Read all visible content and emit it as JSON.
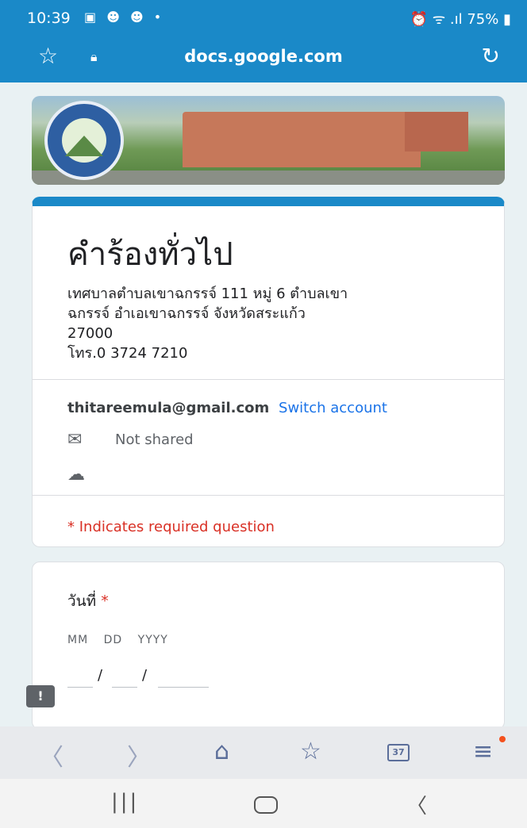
{
  "status_bar": {
    "time": "10:39",
    "notification_icons": "▣ ☻ ☻ •",
    "right_status": "⏰ ᯤ .ıl 75% ▮"
  },
  "browser": {
    "url": "docs.google.com"
  },
  "form": {
    "title": "คำร้องทั่วไป",
    "description_lines": [
      "เทศบาลตำบลเขาฉกรรจ์ 111 หมู่ 6 ตำบลเขา",
      "ฉกรรจ์ อำเอเขาฉกรรจ์ จังหวัดสระแก้ว",
      "27000",
      "โทร.0 3724 7210"
    ],
    "account_email": "thitareemula@gmail.com",
    "switch_account_label": "Switch account",
    "not_shared_label": "Not shared",
    "required_note": "* Indicates required question"
  },
  "question": {
    "label": "วันที่",
    "required_mark": "*",
    "date_format": {
      "mm": "MM",
      "dd": "DD",
      "yyyy": "YYYY"
    },
    "separator": "/"
  },
  "icons": {
    "star": "favorite-star-icon",
    "lock": "lock-icon",
    "reload": "reload-icon",
    "not_shared": "mail-not-shared-icon",
    "cloud": "cloud-saved-icon",
    "feedback": "feedback-icon",
    "back": "back-icon",
    "forward": "forward-icon",
    "home": "home-icon",
    "bookmarks": "bookmarks-icon",
    "tabs": "tabs-icon",
    "menu": "menu-icon"
  },
  "bottom_nav": {
    "tabs_count": "37"
  },
  "colors": {
    "accent": "#1a89c8",
    "required": "#d93025",
    "link": "#1a73e8"
  }
}
